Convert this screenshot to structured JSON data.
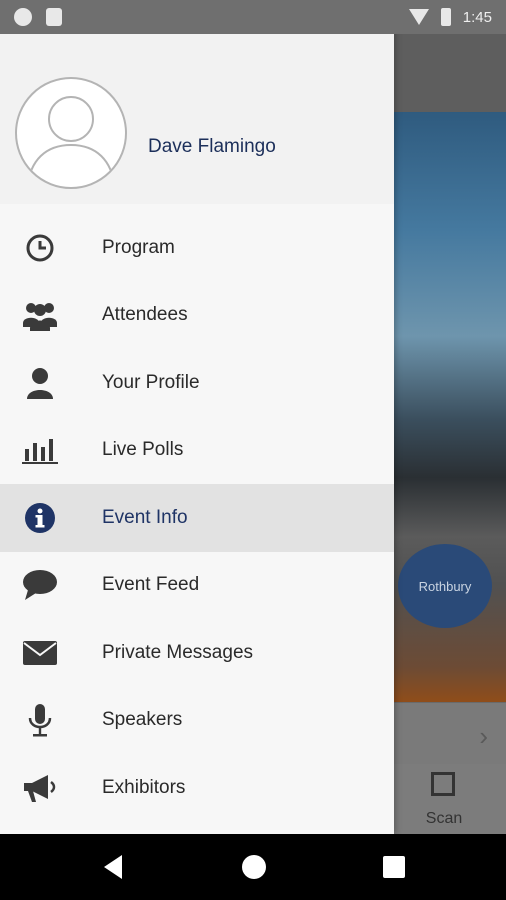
{
  "user": {
    "name": "Dave Flamingo"
  },
  "menu": [
    {
      "label": "Program",
      "icon": "clock-icon",
      "active": false
    },
    {
      "label": "Attendees",
      "icon": "people-icon",
      "active": false
    },
    {
      "label": "Your Profile",
      "icon": "person-icon",
      "active": false
    },
    {
      "label": "Live Polls",
      "icon": "bar-chart-icon",
      "active": false
    },
    {
      "label": "Event Info",
      "icon": "info-icon",
      "active": true
    },
    {
      "label": "Event Feed",
      "icon": "speech-bubble-icon",
      "active": false
    },
    {
      "label": "Private Messages",
      "icon": "envelope-icon",
      "active": false
    },
    {
      "label": "Speakers",
      "icon": "microphone-icon",
      "active": false
    },
    {
      "label": "Exhibitors",
      "icon": "megaphone-icon",
      "active": false
    }
  ],
  "background": {
    "sponsor_logo": "Rothbury",
    "scan_label": "Scan"
  },
  "status_bar": {
    "time": "1:45"
  },
  "colors": {
    "accent": "#1f3466",
    "active_row": "#e2e2e2",
    "icon": "#3a3a3a"
  }
}
